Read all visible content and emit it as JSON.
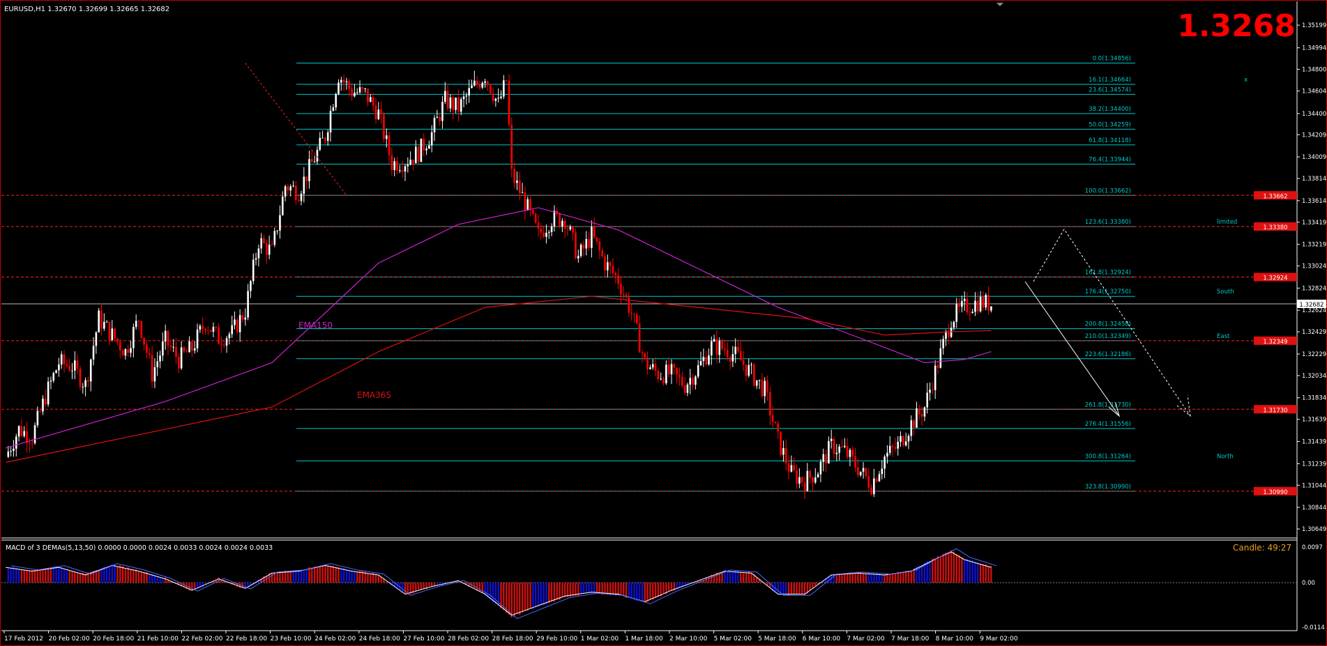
{
  "window": {
    "symbol_header": "EURUSD,H1  1.32670 1.32699 1.32665 1.32682",
    "big_price": "1.3268",
    "indicator_header": "MACD of 3 DEMAs(5,13,50) 0.0000 0.0000 0.0024 0.0033 0.0024 0.0024 0.0033",
    "candle_timer": "Candle:  49:27"
  },
  "colors": {
    "background": "#000000",
    "bull_candle": "#ffffff",
    "bear_candle": "#ff0000",
    "fib_line": "#00c8c8",
    "dashed_level": "#ff2020",
    "ema150": "#d020d0",
    "ema365": "#e01010",
    "macd_blue": "#1010d0",
    "macd_red": "#d01010"
  },
  "chart_data": [
    {
      "type": "candlestick",
      "title": "EURUSD,H1",
      "y_axis_labels": [
        "1.35199",
        "1.34994",
        "1.34800",
        "1.34604",
        "1.34400",
        "1.34209",
        "1.34009",
        "1.33814",
        "1.33614",
        "1.33419",
        "1.33219",
        "1.33024",
        "1.32824",
        "1.32624",
        "1.32429",
        "1.32229",
        "1.32034",
        "1.31834",
        "1.31639",
        "1.31439",
        "1.31239",
        "1.31044",
        "1.30844",
        "1.30649"
      ],
      "ylim": [
        1.3058,
        1.353
      ],
      "x_axis_labels": [
        "17 Feb 2012",
        "20 Feb 02:00",
        "20 Feb 18:00",
        "21 Feb 10:00",
        "22 Feb 02:00",
        "22 Feb 18:00",
        "23 Feb 10:00",
        "24 Feb 02:00",
        "24 Feb 18:00",
        "27 Feb 10:00",
        "28 Feb 02:00",
        "28 Feb 18:00",
        "29 Feb 10:00",
        "1 Mar 02:00",
        "1 Mar 18:00",
        "2 Mar 10:00",
        "5 Mar 02:00",
        "5 Mar 18:00",
        "6 Mar 10:00",
        "7 Mar 02:00",
        "7 Mar 18:00",
        "8 Mar 10:00",
        "9 Mar 02:00"
      ],
      "price_path": [
        [
          0,
          1.313
        ],
        [
          5,
          1.3155
        ],
        [
          10,
          1.3148
        ],
        [
          15,
          1.3185
        ],
        [
          20,
          1.3215
        ],
        [
          25,
          1.3212
        ],
        [
          30,
          1.3195
        ],
        [
          35,
          1.3255
        ],
        [
          40,
          1.324
        ],
        [
          45,
          1.3225
        ],
        [
          50,
          1.3255
        ],
        [
          55,
          1.3205
        ],
        [
          60,
          1.3235
        ],
        [
          65,
          1.3218
        ],
        [
          70,
          1.3228
        ],
        [
          75,
          1.3252
        ],
        [
          80,
          1.3237
        ],
        [
          85,
          1.3242
        ],
        [
          90,
          1.3262
        ],
        [
          95,
          1.3325
        ],
        [
          100,
          1.3315
        ],
        [
          105,
          1.3375
        ],
        [
          110,
          1.337
        ],
        [
          115,
          1.3395
        ],
        [
          120,
          1.342
        ],
        [
          125,
          1.3475
        ],
        [
          130,
          1.346
        ],
        [
          135,
          1.3458
        ],
        [
          140,
          1.344
        ],
        [
          145,
          1.3395
        ],
        [
          150,
          1.3397
        ],
        [
          155,
          1.3405
        ],
        [
          160,
          1.3422
        ],
        [
          165,
          1.3452
        ],
        [
          170,
          1.3445
        ],
        [
          175,
          1.3462
        ],
        [
          180,
          1.3475
        ],
        [
          185,
          1.3448
        ],
        [
          188,
          1.347
        ],
        [
          190,
          1.3385
        ],
        [
          195,
          1.336
        ],
        [
          200,
          1.333
        ],
        [
          205,
          1.3345
        ],
        [
          210,
          1.3345
        ],
        [
          215,
          1.331
        ],
        [
          220,
          1.333
        ],
        [
          225,
          1.3305
        ],
        [
          230,
          1.329
        ],
        [
          235,
          1.326
        ],
        [
          240,
          1.3215
        ],
        [
          245,
          1.3205
        ],
        [
          250,
          1.3205
        ],
        [
          255,
          1.3195
        ],
        [
          260,
          1.321
        ],
        [
          265,
          1.323
        ],
        [
          270,
          1.3228
        ],
        [
          275,
          1.322
        ],
        [
          280,
          1.3205
        ],
        [
          285,
          1.319
        ],
        [
          290,
          1.3145
        ],
        [
          295,
          1.3115
        ],
        [
          300,
          1.3108
        ],
        [
          305,
          1.3118
        ],
        [
          310,
          1.314
        ],
        [
          315,
          1.3135
        ],
        [
          320,
          1.312
        ],
        [
          325,
          1.3105
        ],
        [
          330,
          1.313
        ],
        [
          335,
          1.314
        ],
        [
          340,
          1.316
        ],
        [
          345,
          1.3175
        ],
        [
          350,
          1.3215
        ],
        [
          355,
          1.3255
        ],
        [
          360,
          1.3265
        ],
        [
          365,
          1.327
        ],
        [
          370,
          1.3268
        ]
      ],
      "series": [
        {
          "name": "EMA150",
          "path": [
            [
              0,
              1.3138
            ],
            [
              60,
              1.318
            ],
            [
              100,
              1.3215
            ],
            [
              140,
              1.3305
            ],
            [
              170,
              1.334
            ],
            [
              200,
              1.3355
            ],
            [
              230,
              1.3335
            ],
            [
              260,
              1.33
            ],
            [
              290,
              1.3265
            ],
            [
              320,
              1.3238
            ],
            [
              345,
              1.3215
            ],
            [
              360,
              1.3218
            ],
            [
              370,
              1.3225
            ]
          ]
        },
        {
          "name": "EMA365",
          "path": [
            [
              0,
              1.3125
            ],
            [
              60,
              1.3155
            ],
            [
              100,
              1.3175
            ],
            [
              140,
              1.3225
            ],
            [
              180,
              1.3265
            ],
            [
              220,
              1.3275
            ],
            [
              260,
              1.3265
            ],
            [
              300,
              1.3255
            ],
            [
              330,
              1.324
            ],
            [
              355,
              1.3243
            ],
            [
              370,
              1.3244
            ]
          ]
        }
      ],
      "fib_levels": [
        {
          "label": "0.0(1.34856)",
          "price": 1.34856
        },
        {
          "label": "16.1(1.34664)",
          "price": 1.34664
        },
        {
          "label": "23.6(1.34574)",
          "price": 1.34574
        },
        {
          "label": "38.2(1.34400)",
          "price": 1.344
        },
        {
          "label": "50.0(1.34259)",
          "price": 1.34259
        },
        {
          "label": "61.8(1.34118)",
          "price": 1.34118
        },
        {
          "label": "76.4(1.33944)",
          "price": 1.33944
        },
        {
          "label": "100.0(1.33662)",
          "price": 1.33662
        },
        {
          "label": "123.6(1.33380)",
          "price": 1.3338,
          "tag": "limited"
        },
        {
          "label": "161.8(1.32924)",
          "price": 1.32924
        },
        {
          "label": "176.4(1.32750)",
          "price": 1.3275,
          "tag": "South"
        },
        {
          "label": "200.8(1.32458)",
          "price": 1.32458
        },
        {
          "label": "210.0(1.32349)",
          "price": 1.32349,
          "tag": "East"
        },
        {
          "label": "223.6(1.32186)",
          "price": 1.32186
        },
        {
          "label": "261.8(1.31730)",
          "price": 1.3173
        },
        {
          "label": "276.4(1.31556)",
          "price": 1.31556
        },
        {
          "label": "300.8(1.31264)",
          "price": 1.31264,
          "tag": "North"
        },
        {
          "label": "323.8(1.30990)",
          "price": 1.3099
        }
      ],
      "dashed_levels": [
        {
          "price": 1.33662,
          "label": "1.33662"
        },
        {
          "price": 1.3338,
          "label": "1.33380"
        },
        {
          "price": 1.32924,
          "label": "1.32924"
        },
        {
          "price": 1.32349,
          "label": "1.32349"
        },
        {
          "price": 1.3173,
          "label": "1.31730"
        },
        {
          "price": 1.3099,
          "label": "1.30990"
        }
      ],
      "current_price": {
        "price": 1.32682,
        "label": "1.32682"
      },
      "annotations": {
        "ema150_label": "EMA150",
        "ema365_label": "EMA365",
        "fib_x_mark": "x"
      }
    },
    {
      "type": "histogram",
      "title": "MACD of 3 DEMAs(5,13,50)",
      "y_axis_labels": [
        "0.0097",
        "0.00",
        "-0.0114"
      ],
      "ylim": [
        -0.0114,
        0.0097
      ],
      "histogram_path": [
        [
          0,
          0.004
        ],
        [
          10,
          0.003
        ],
        [
          20,
          0.004
        ],
        [
          30,
          0.002
        ],
        [
          40,
          0.0045
        ],
        [
          50,
          0.003
        ],
        [
          60,
          0.001
        ],
        [
          70,
          -0.002
        ],
        [
          80,
          0.001
        ],
        [
          90,
          -0.0015
        ],
        [
          100,
          0.0025
        ],
        [
          110,
          0.003
        ],
        [
          120,
          0.0045
        ],
        [
          130,
          0.003
        ],
        [
          140,
          0.002
        ],
        [
          150,
          -0.003
        ],
        [
          160,
          -0.001
        ],
        [
          170,
          0.0005
        ],
        [
          180,
          -0.003
        ],
        [
          190,
          -0.0085
        ],
        [
          200,
          -0.006
        ],
        [
          210,
          -0.0035
        ],
        [
          220,
          -0.0025
        ],
        [
          230,
          -0.003
        ],
        [
          240,
          -0.005
        ],
        [
          250,
          -0.002
        ],
        [
          260,
          0.0005
        ],
        [
          270,
          0.003
        ],
        [
          280,
          0.0025
        ],
        [
          290,
          -0.003
        ],
        [
          300,
          -0.003
        ],
        [
          310,
          0.002
        ],
        [
          320,
          0.0025
        ],
        [
          330,
          0.002
        ],
        [
          340,
          0.003
        ],
        [
          350,
          0.0065
        ],
        [
          355,
          0.008
        ],
        [
          360,
          0.006
        ],
        [
          370,
          0.004
        ]
      ]
    }
  ]
}
